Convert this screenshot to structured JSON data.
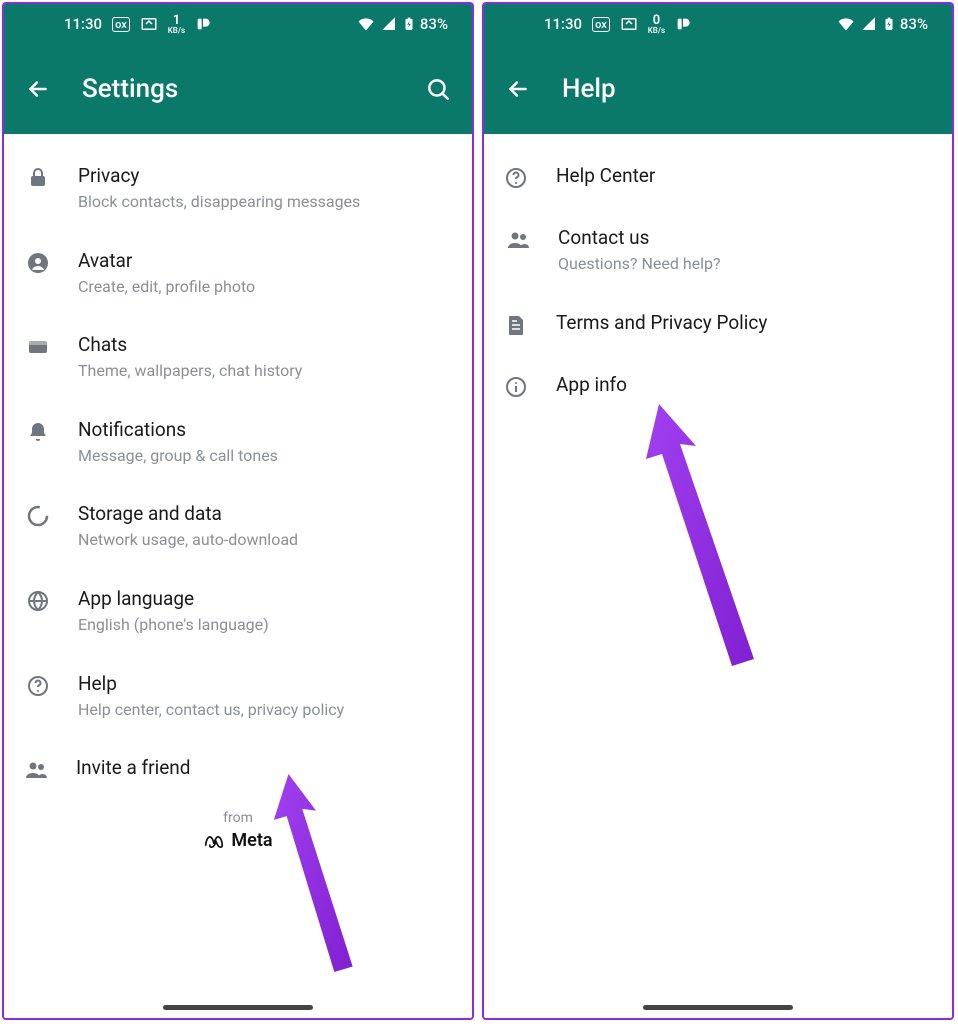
{
  "status": {
    "time": "11:30",
    "speed_value": "1",
    "speed_unit": "KB/s",
    "battery": "83%"
  },
  "status2": {
    "time": "11:30",
    "speed_value": "0",
    "speed_unit": "KB/s",
    "battery": "83%"
  },
  "screenA": {
    "title": "Settings",
    "items": [
      {
        "icon": "lock-icon",
        "title": "Privacy",
        "sub": "Block contacts, disappearing messages"
      },
      {
        "icon": "avatar-icon",
        "title": "Avatar",
        "sub": "Create, edit, profile photo"
      },
      {
        "icon": "chats-icon",
        "title": "Chats",
        "sub": "Theme, wallpapers, chat history"
      },
      {
        "icon": "bell-icon",
        "title": "Notifications",
        "sub": "Message, group & call tones"
      },
      {
        "icon": "data-icon",
        "title": "Storage and data",
        "sub": "Network usage, auto-download"
      },
      {
        "icon": "globe-icon",
        "title": "App language",
        "sub": "English (phone's language)"
      },
      {
        "icon": "help-icon",
        "title": "Help",
        "sub": "Help center, contact us, privacy policy"
      },
      {
        "icon": "invite-icon",
        "title": "Invite a friend",
        "sub": ""
      }
    ],
    "footer_from": "from",
    "footer_brand": "Meta"
  },
  "screenB": {
    "title": "Help",
    "items": [
      {
        "icon": "help-icon",
        "title": "Help Center",
        "sub": ""
      },
      {
        "icon": "contact-icon",
        "title": "Contact us",
        "sub": "Questions? Need help?"
      },
      {
        "icon": "doc-icon",
        "title": "Terms and Privacy Policy",
        "sub": ""
      },
      {
        "icon": "info-icon",
        "title": "App info",
        "sub": ""
      }
    ]
  }
}
